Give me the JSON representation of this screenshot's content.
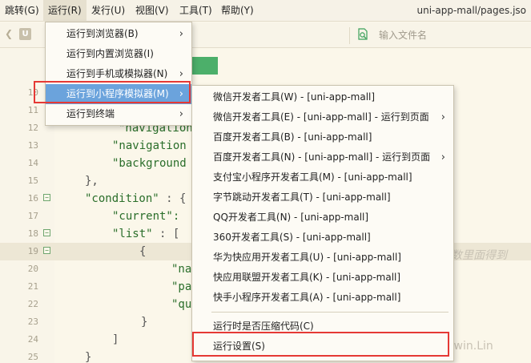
{
  "menubar": {
    "items": [
      {
        "label": "跳转(G)"
      },
      {
        "label": "运行(R)"
      },
      {
        "label": "发行(U)"
      },
      {
        "label": "视图(V)"
      },
      {
        "label": "工具(T)"
      },
      {
        "label": "帮助(Y)"
      }
    ],
    "title": "uni-app-mall/pages.jso"
  },
  "toolbar": {
    "logo": "U",
    "file_search_placeholder": "输入文件名",
    "search_icon": "file-search-icon"
  },
  "editor": {
    "line_numbers": [
      "10",
      "11",
      "12",
      "13",
      "14",
      "15",
      "16",
      "17",
      "18",
      "19",
      "20",
      "21",
      "22",
      "23",
      "24",
      "25"
    ],
    "lines": {
      "l12": "\"navigation",
      "l13": "\"navigation",
      "l14": "\"background",
      "l15": "},",
      "l16a": "\"condition\"",
      "l16b": " : {",
      "l17": "\"current\":",
      "l18a": "\"list\"",
      "l18b": ": [",
      "l19": "{",
      "l20": "\"na",
      "l21": "\"pa",
      "l22": "\"qu",
      "l23": "}",
      "l24": "]",
      "l25": "}"
    },
    "ghost_text": "数里面得到"
  },
  "run_menu": {
    "items": [
      {
        "label": "运行到浏览器(B)",
        "submenu": true
      },
      {
        "label": "运行到内置浏览器(I)",
        "submenu": false
      },
      {
        "label": "运行到手机或模拟器(N)",
        "submenu": true
      },
      {
        "label": "运行到小程序模拟器(M)",
        "submenu": true,
        "highlighted": true
      },
      {
        "label": "运行到终端",
        "submenu": true
      }
    ]
  },
  "mp_menu": {
    "items": [
      {
        "label": "微信开发者工具(W) - [uni-app-mall]",
        "submenu": false
      },
      {
        "label": "微信开发者工具(E) - [uni-app-mall] - 运行到页面",
        "submenu": true
      },
      {
        "label": "百度开发者工具(B) - [uni-app-mall]",
        "submenu": false
      },
      {
        "label": "百度开发者工具(N) - [uni-app-mall] - 运行到页面",
        "submenu": true
      },
      {
        "label": "支付宝小程序开发者工具(M) - [uni-app-mall]",
        "submenu": false
      },
      {
        "label": "字节跳动开发者工具(T) - [uni-app-mall]",
        "submenu": false
      },
      {
        "label": "QQ开发者工具(N) - [uni-app-mall]",
        "submenu": false
      },
      {
        "label": "360开发者工具(S) - [uni-app-mall]",
        "submenu": false
      },
      {
        "label": "华为快应用开发者工具(U) - [uni-app-mall]",
        "submenu": false
      },
      {
        "label": "快应用联盟开发者工具(K) - [uni-app-mall]",
        "submenu": false
      },
      {
        "label": "快手小程序开发者工具(A) - [uni-app-mall]",
        "submenu": false
      },
      {
        "label": "运行时是否压缩代码(C)",
        "submenu": false
      },
      {
        "label": "运行设置(S)",
        "submenu": false
      }
    ]
  },
  "watermark": "CSDN @Lewin.Lin",
  "colors": {
    "menu_highlight": "#6ba3dc",
    "annotation_red": "#e53935",
    "code_green": "#2a6e2a",
    "background": "#fbf7ea"
  }
}
